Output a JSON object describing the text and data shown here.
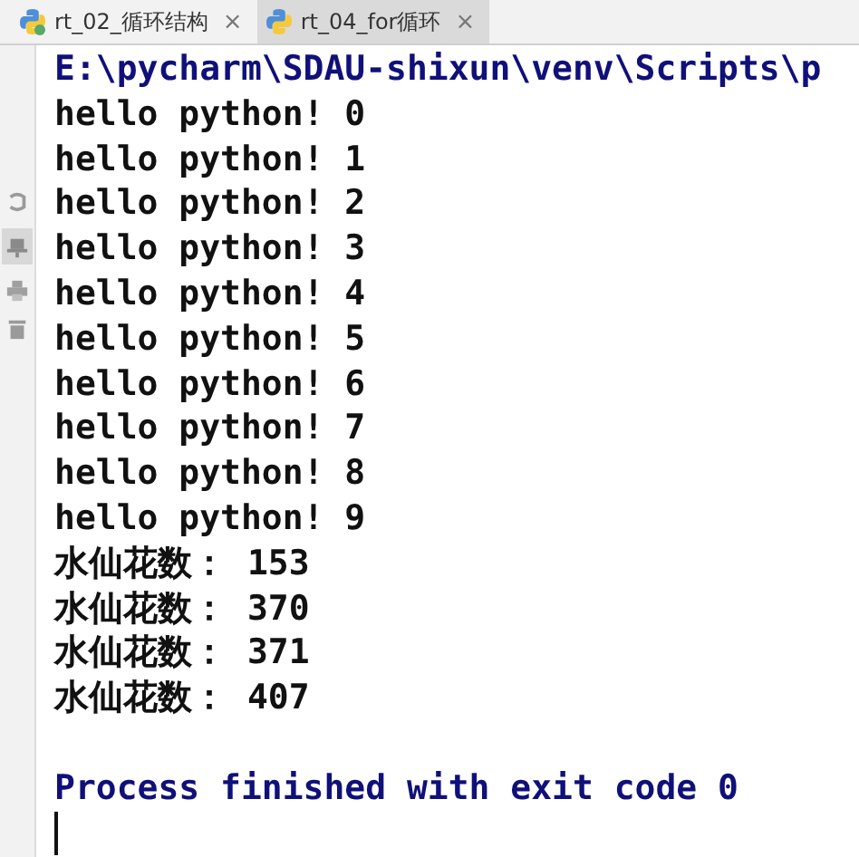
{
  "tabs": [
    {
      "label": "rt_02_循环结构",
      "close": "×",
      "selected": false
    },
    {
      "label": "rt_04_for循环",
      "close": "×",
      "selected": true
    }
  ],
  "console": {
    "lines": [
      {
        "kind": "command",
        "text": "E:\\pycharm\\SDAU-shixun\\venv\\Scripts\\p"
      },
      {
        "kind": "output",
        "text": "hello python! 0"
      },
      {
        "kind": "output",
        "text": "hello python! 1"
      },
      {
        "kind": "output",
        "text": "hello python! 2"
      },
      {
        "kind": "output",
        "text": "hello python! 3"
      },
      {
        "kind": "output",
        "text": "hello python! 4"
      },
      {
        "kind": "output",
        "text": "hello python! 5"
      },
      {
        "kind": "output",
        "text": "hello python! 6"
      },
      {
        "kind": "output",
        "text": "hello python! 7"
      },
      {
        "kind": "output",
        "text": "hello python! 8"
      },
      {
        "kind": "output",
        "text": "hello python! 9"
      },
      {
        "kind": "output",
        "text": "水仙花数： 153"
      },
      {
        "kind": "output",
        "text": "水仙花数： 370"
      },
      {
        "kind": "output",
        "text": "水仙花数： 371"
      },
      {
        "kind": "output",
        "text": "水仙花数： 407"
      },
      {
        "kind": "blank"
      },
      {
        "kind": "exit",
        "text": "Process finished with exit code 0"
      },
      {
        "kind": "cursor"
      }
    ]
  }
}
